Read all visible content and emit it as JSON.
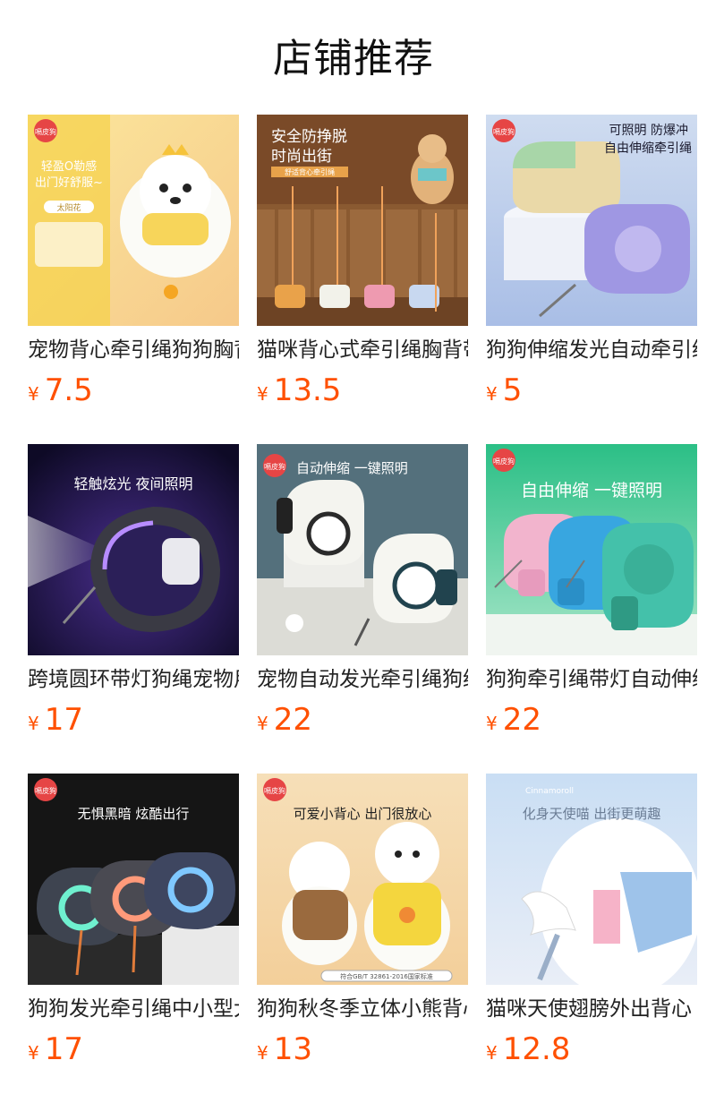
{
  "page": {
    "title": "店铺推荐",
    "currency": "¥"
  },
  "products": [
    {
      "name": "宠物背心牵引绳狗狗胸背带",
      "price": "7.5",
      "image": {
        "brand": "嗝皮狗",
        "line1": "轻盈O勒感",
        "line2": "出门好舒服~",
        "tag": "太阳花"
      }
    },
    {
      "name": "猫咪背心式牵引绳胸背带",
      "price": "13.5",
      "image": {
        "line1": "安全防挣脱",
        "line2": "时尚出街",
        "tag": "舒适背心牵引绳"
      }
    },
    {
      "name": "狗狗伸缩发光自动牵引绳",
      "price": "5",
      "image": {
        "brand": "嗝皮狗",
        "line1": "可照明 防爆冲",
        "line2": "自由伸缩牵引绳"
      }
    },
    {
      "name": "跨境圆环带灯狗绳宠物用品",
      "price": "17",
      "image": {
        "line1": "轻触炫光 夜间照明"
      }
    },
    {
      "name": "宠物自动发光牵引绳狗绳",
      "price": "22",
      "image": {
        "brand": "嗝皮狗",
        "line1": "自动伸缩 一键照明"
      }
    },
    {
      "name": "狗狗牵引绳带灯自动伸缩",
      "price": "22",
      "image": {
        "brand": "嗝皮狗",
        "line1": "自由伸缩 一键照明"
      }
    },
    {
      "name": "狗狗发光牵引绳中小型犬",
      "price": "17",
      "image": {
        "brand": "嗝皮狗",
        "line1": "无惧黑暗  炫酷出行"
      }
    },
    {
      "name": "狗狗秋冬季立体小熊背心",
      "price": "13",
      "image": {
        "brand": "嗝皮狗",
        "line1": "可爱小背心  出门很放心",
        "tag": "符合GB/T 32861-2016国家标准"
      }
    },
    {
      "name": "猫咪天使翅膀外出背心",
      "price": "12.8",
      "image": {
        "brand": "Cinnamoroll",
        "line1": "化身天使喵 出街更萌趣"
      }
    }
  ]
}
